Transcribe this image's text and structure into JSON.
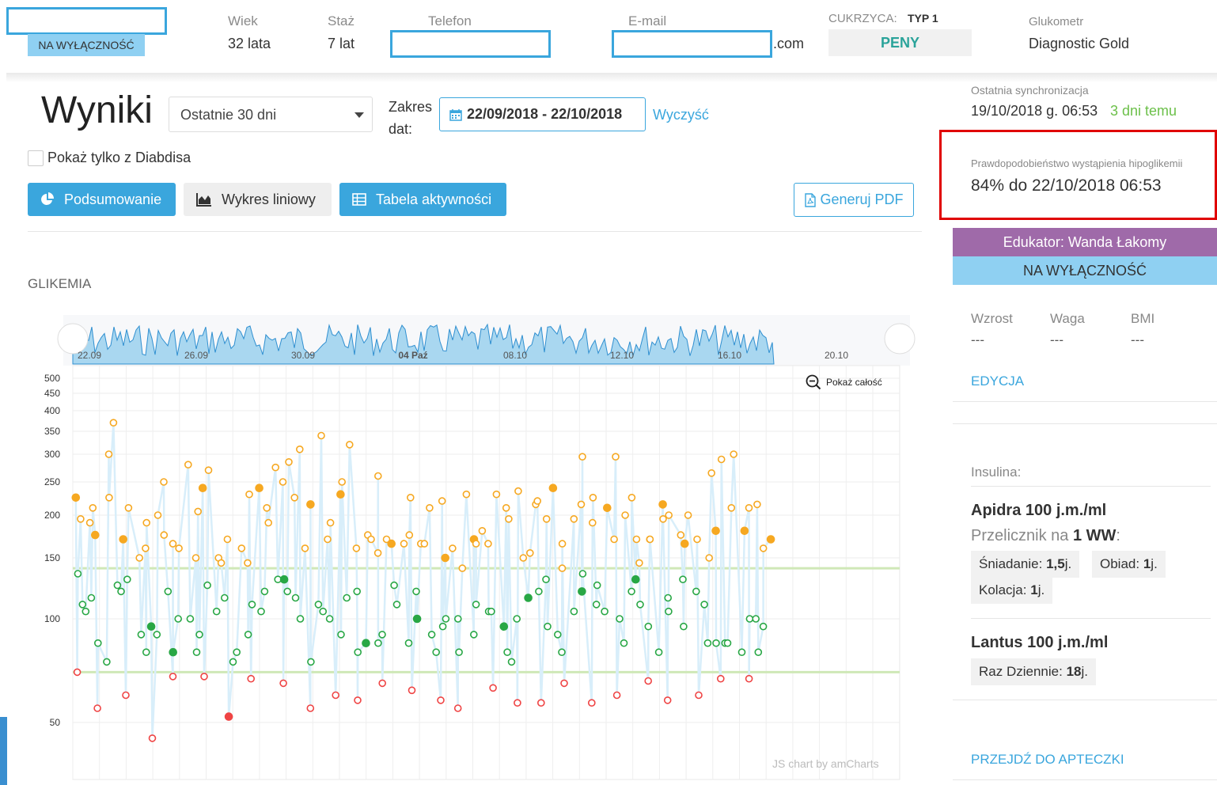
{
  "header": {
    "exclusive_badge": "NA WYŁĄCZNOŚĆ",
    "age_label": "Wiek",
    "age_value": "32 lata",
    "tenure_label": "Staż",
    "tenure_value": "7 lat",
    "phone_label": "Telefon",
    "email_label": "E-mail",
    "email_suffix": ".com",
    "diabetes_label": "CUKRZYCA:",
    "diabetes_type": "TYP 1",
    "diabetes_status": "PENY",
    "glucometer_label": "Glukometr",
    "glucometer_value": "Diagnostic Gold"
  },
  "results": {
    "title": "Wyniki",
    "range_select": "Ostatnie 30 dni",
    "range_label_1": "Zakres",
    "range_label_2": "dat:",
    "date_range": "22/09/2018 - 22/10/2018",
    "clear_link": "Wyczyść",
    "only_diabdis_label": "Pokaż tylko z Diabdisa",
    "tab_summary": "Podsumowanie",
    "tab_line": "Wykres liniowy",
    "tab_activity": "Tabela aktywności",
    "pdf_button": "Generuj PDF",
    "section_label": "GLIKEMIA",
    "zoom_out_label": "Pokaż całość",
    "credit": "JS chart by amCharts",
    "navigator_labels": [
      "22.09",
      "26.09",
      "30.09",
      "04 Paź",
      "08.10",
      "12.10",
      "16.10",
      "20.10"
    ]
  },
  "sidebar": {
    "sync_label": "Ostatnia synchronizacja",
    "sync_value": "19/10/2018 g. 06:53",
    "sync_ago": "3 dni temu",
    "hypo_label": "Prawdopodobieństwo wystąpienia hipoglikemii",
    "hypo_value": "84% do 22/10/2018 06:53",
    "educator": "Edukator: Wanda Łakomy",
    "exclusive": "NA WYŁĄCZNOŚĆ",
    "height_label": "Wzrost",
    "height_value": "---",
    "weight_label": "Waga",
    "weight_value": "---",
    "bmi_label": "BMI",
    "bmi_value": "---",
    "edit_link": "EDYCJA",
    "insulin_label": "Insulina:",
    "insulin1_name": "Apidra 100 j.m./ml",
    "insulin1_ratio_prefix": "Przelicznik na ",
    "insulin1_ratio_unit": "1 WW",
    "insulin1_ratio_suffix": ":",
    "breakfast_label": "Śniadanie: ",
    "breakfast_value": "1,5",
    "lunch_label": "Obiad: ",
    "lunch_value": "1",
    "dinner_label": "Kolacja: ",
    "dinner_value": "1",
    "unit_suffix": " j.",
    "insulin2_name": "Lantus 100 j.m./ml",
    "insulin2_dose_label": "Raz Dziennie: ",
    "insulin2_dose_value": "18",
    "pharmacy_link": "PRZEJDŹ DO APTECZKI"
  },
  "colors": {
    "accent": "#3aa6dd",
    "educator_bg": "#9f6aa9",
    "exclusive_bg": "#8fd0f2",
    "high": "#f6a821",
    "normal": "#28a745",
    "low": "#ef4444",
    "green_text": "#6cc04a",
    "highlight_border": "#e00000"
  },
  "chart_data": {
    "type": "scatter",
    "y_axis_scale": "log",
    "y_ticks": [
      50,
      100,
      150,
      200,
      250,
      300,
      350,
      400,
      450,
      500
    ],
    "target_range": [
      70,
      140
    ],
    "date_range": [
      "2018-09-22",
      "2018-10-22"
    ],
    "series": [
      {
        "name": "high",
        "color": "#f6a821",
        "y": [
          225,
          195,
          190,
          210,
          175,
          300,
          225,
          370,
          170,
          210,
          150,
          190,
          160,
          200,
          250,
          175,
          165,
          160,
          280,
          205,
          150,
          240,
          270,
          150,
          145,
          170,
          160,
          145,
          230,
          240,
          210,
          190,
          275,
          250,
          285,
          225,
          310,
          160,
          215,
          340,
          190,
          170,
          250,
          230,
          320,
          160,
          175,
          170,
          155,
          260,
          170,
          165,
          165,
          175,
          225,
          165,
          165,
          210,
          220,
          150,
          160,
          140,
          230,
          170,
          165,
          180,
          165,
          230,
          210,
          195,
          235,
          150,
          155,
          215,
          220,
          195,
          240,
          140,
          165,
          195,
          295,
          215,
          225,
          190,
          210,
          170,
          295,
          200,
          225,
          170,
          145,
          170,
          170,
          215,
          195,
          200,
          175,
          165,
          200,
          170,
          150,
          265,
          180,
          290,
          300,
          210,
          180,
          210,
          215,
          160,
          170
        ]
      },
      {
        "name": "normal",
        "color": "#28a745",
        "y": [
          135,
          110,
          105,
          115,
          85,
          75,
          125,
          120,
          130,
          90,
          80,
          95,
          90,
          120,
          80,
          100,
          100,
          80,
          90,
          125,
          105,
          115,
          75,
          80,
          90,
          110,
          105,
          120,
          130,
          130,
          120,
          115,
          100,
          75,
          110,
          105,
          100,
          90,
          115,
          120,
          80,
          85,
          85,
          90,
          125,
          110,
          85,
          120,
          100,
          90,
          80,
          95,
          100,
          100,
          80,
          90,
          110,
          105,
          105,
          95,
          80,
          75,
          100,
          115,
          120,
          95,
          130,
          90,
          80,
          105,
          120,
          135,
          125,
          110,
          105,
          100,
          85,
          120,
          130,
          110,
          95,
          80,
          115,
          105,
          95,
          130,
          120,
          110,
          85,
          85,
          85,
          85,
          80,
          100,
          100,
          80,
          95
        ]
      },
      {
        "name": "low",
        "color": "#ef4444",
        "y": [
          70,
          55,
          60,
          45,
          68,
          68,
          52,
          67,
          65,
          55,
          60,
          58,
          65,
          62,
          58,
          55,
          63,
          57,
          57,
          65,
          57,
          60,
          66,
          58,
          60,
          67,
          67
        ]
      }
    ]
  }
}
